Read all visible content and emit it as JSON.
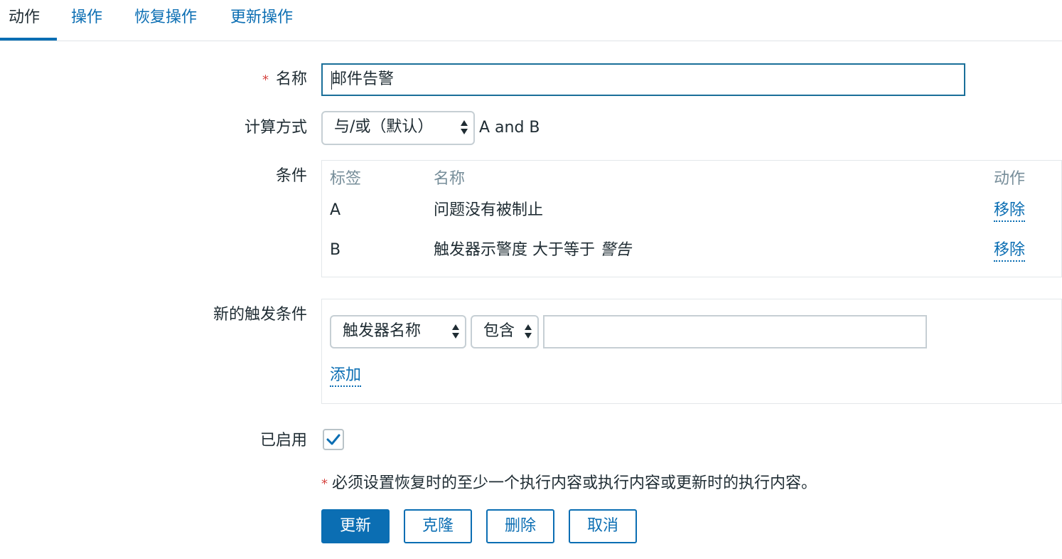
{
  "tabs": [
    {
      "label": "动作",
      "active": true
    },
    {
      "label": "操作"
    },
    {
      "label": "恢复操作"
    },
    {
      "label": "更新操作"
    }
  ],
  "form": {
    "required_mark": "*",
    "name_label": "名称",
    "name_value": "邮件告警",
    "calc_label": "计算方式",
    "calc_select": "与/或（默认）",
    "calc_formula": "A and B",
    "conditions_label": "条件",
    "conditions": {
      "headers": [
        "标签",
        "名称",
        "动作"
      ],
      "rows": [
        {
          "label": "A",
          "name": "问题没有被制止",
          "name_em": "",
          "action": "移除"
        },
        {
          "label": "B",
          "name": "触发器示警度 大于等于 ",
          "name_em": "警告",
          "action": "移除"
        }
      ]
    },
    "new_condition_label": "新的触发条件",
    "new_condition": {
      "type_select": "触发器名称",
      "operator_select": "包含",
      "value": "",
      "add_link": "添加"
    },
    "enabled_label": "已启用",
    "enabled": true,
    "note": "必须设置恢复时的至少一个执行内容或执行内容或更新时的执行内容。"
  },
  "buttons": {
    "update": "更新",
    "clone": "克隆",
    "delete": "删除",
    "cancel": "取消"
  },
  "colors": {
    "accent": "#0b6eb3",
    "required": "#d64541",
    "header_text": "#768d99"
  }
}
